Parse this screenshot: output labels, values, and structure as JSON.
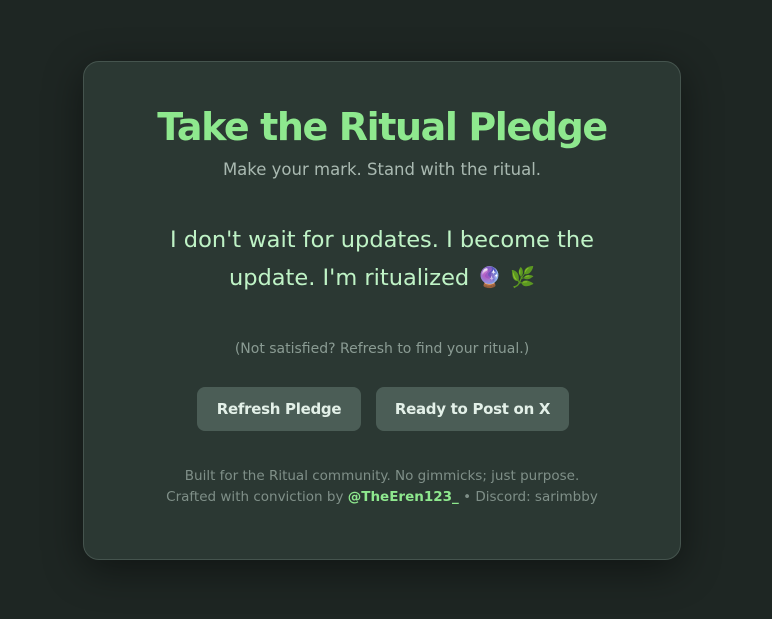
{
  "colors": {
    "page_background": "#1e2623",
    "card_background": "#2b3833",
    "accent_green": "#8ee88e",
    "button_background": "#4b5d56"
  },
  "card": {
    "title": "Take the Ritual Pledge",
    "subtitle": "Make your mark. Stand with the ritual.",
    "pledge_text": "I don't wait for updates. I become the update. I'm ritualized",
    "pledge_emojis": [
      "🔮",
      "🌿"
    ],
    "hint": "(Not satisfied? Refresh to find your ritual.)",
    "buttons": {
      "refresh_label": "Refresh Pledge",
      "post_label": "Ready to Post on X"
    },
    "footer": {
      "line1": "Built for the Ritual community. No gimmicks; just purpose.",
      "crafted_prefix": "Crafted with conviction by ",
      "handle": "@TheEren123_",
      "separator": " • ",
      "discord": "Discord: sarimbby"
    }
  }
}
